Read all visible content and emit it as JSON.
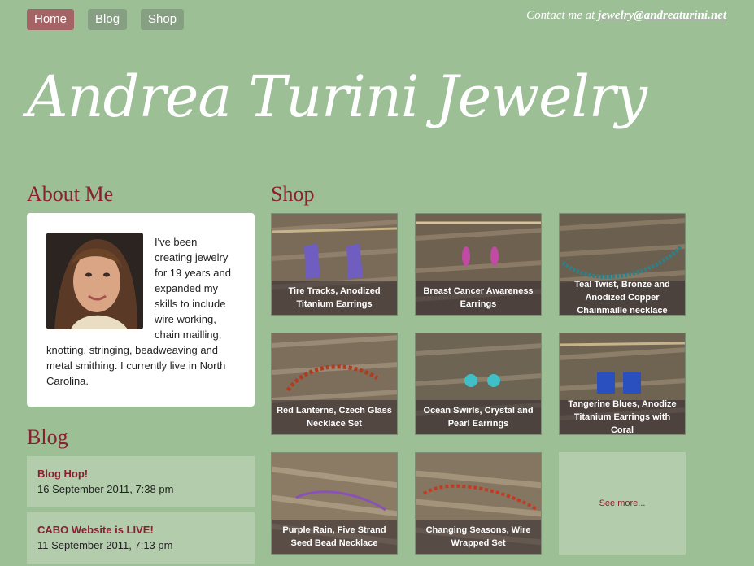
{
  "nav": {
    "home": "Home",
    "blog": "Blog",
    "shop": "Shop"
  },
  "contact": {
    "prefix": "Contact me at ",
    "email": "jewelry@andreaturini.net"
  },
  "site_title": "Andrea Turini Jewelry",
  "about": {
    "heading": "About Me",
    "text": "I've been creating jewelry for 19 years and expanded my skills to include wire working, chain mailling, knotting, stringing, beadweaving and metal smithing. I currently live in North Carolina."
  },
  "blog": {
    "heading": "Blog",
    "posts": [
      {
        "title": "Blog Hop!",
        "date": "16 September 2011, 7:38 pm"
      },
      {
        "title": "CABO Website is LIVE!",
        "date": "11 September 2011, 7:13 pm"
      }
    ]
  },
  "shop": {
    "heading": "Shop",
    "items": [
      "Tire Tracks, Anodized Titanium Earrings",
      "Breast Cancer Awareness Earrings",
      "Teal Twist, Bronze and Anodized Copper Chainmaille necklace",
      "Red Lanterns, Czech Glass Necklace Set",
      "Ocean Swirls, Crystal and Pearl Earrings",
      "Tangerine Blues, Anodize Titanium Earrings with Coral",
      "Purple Rain, Five Strand Seed Bead Necklace",
      "Changing Seasons, Wire Wrapped Set"
    ],
    "see_more": "See more..."
  }
}
